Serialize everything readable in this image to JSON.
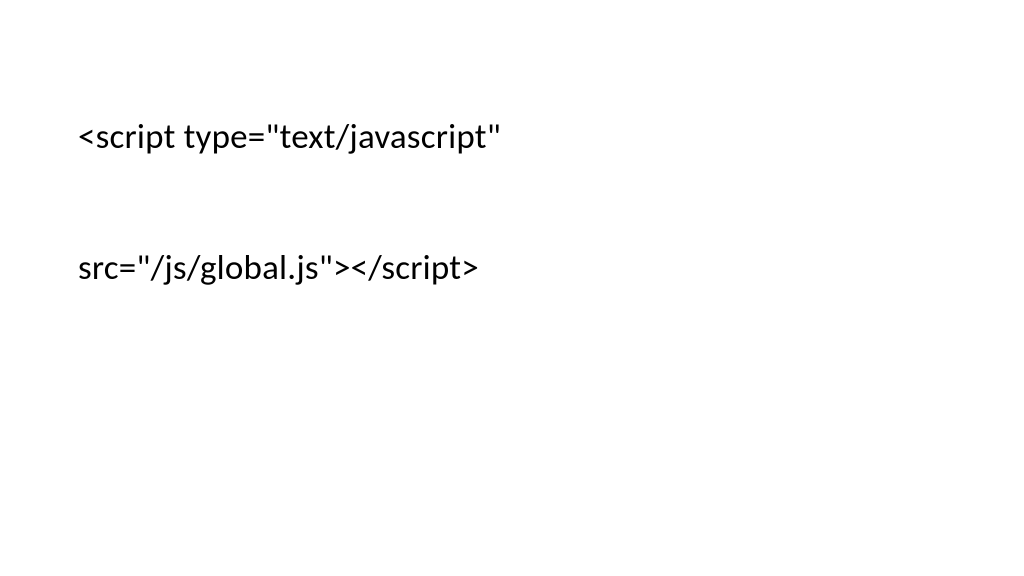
{
  "slide": {
    "code_line_1": "<script type=\"text/javascript\" ",
    "code_line_2": "src=\"/js/global.js\"></script>"
  }
}
